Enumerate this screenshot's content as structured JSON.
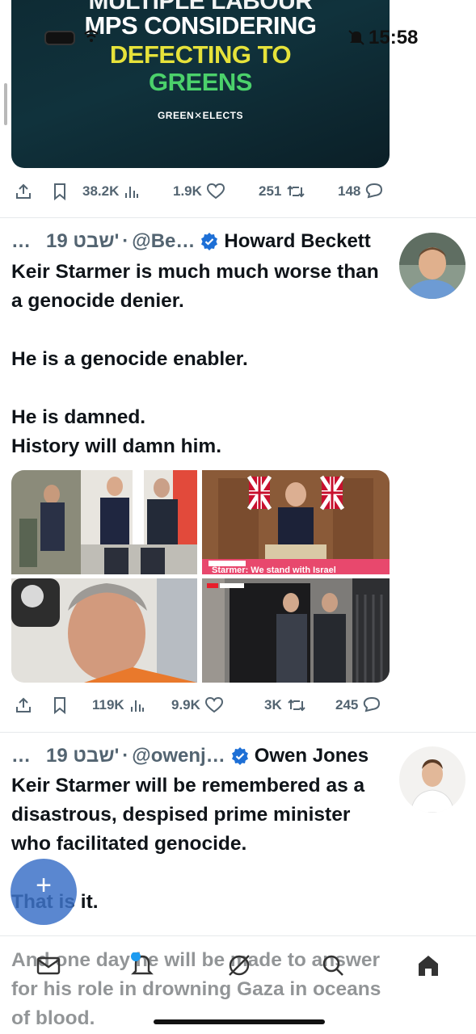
{
  "status_bar": {
    "time": "15:58"
  },
  "top_card": {
    "line0": "MULTIPLE LABOUR",
    "line1": "MPS CONSIDERING",
    "line2": "DEFECTING TO",
    "line3": "GREENS",
    "brand": "GREEN✕ELECTS"
  },
  "post0_actions": {
    "views": "38.2K",
    "likes": "1.9K",
    "reposts": "251",
    "replies": "148"
  },
  "tweet1": {
    "more": "…",
    "date": "19 שבט'",
    "sep": "·",
    "handle": "@Be…",
    "name": "Howard Beckett",
    "text": "Keir Starmer is much much worse than a genocide denier.\n\nHe is a genocide enabler.\n\nHe is damned.\nHistory will damn him.",
    "image_caption_bbc": "Starmer: We stand with Israel",
    "actions": {
      "views": "119K",
      "likes": "9.9K",
      "reposts": "3K",
      "replies": "245"
    }
  },
  "tweet2": {
    "more": "…",
    "date": "19 שבט'",
    "sep": "·",
    "handle": "@owenj…",
    "name": "Owen Jones",
    "text": "Keir Starmer will be remembered as a disastrous, despised prime minister who facilitated genocide.\n\nThat is it.\n\nAnd one day he will be made to answer for his role in drowning Gaza in oceans of blood."
  },
  "fab": {
    "label": "+"
  },
  "colors": {
    "accent": "#1d9bf0",
    "verified": "#1d6fd6",
    "muted": "#536471",
    "text": "#0f1419"
  },
  "icons": {
    "actions": [
      "share-icon",
      "bookmark-icon",
      "views-icon",
      "like-icon",
      "repost-icon",
      "reply-icon"
    ],
    "nav": [
      "messages-icon",
      "notifications-icon",
      "communities-icon",
      "search-icon",
      "home-icon"
    ]
  }
}
